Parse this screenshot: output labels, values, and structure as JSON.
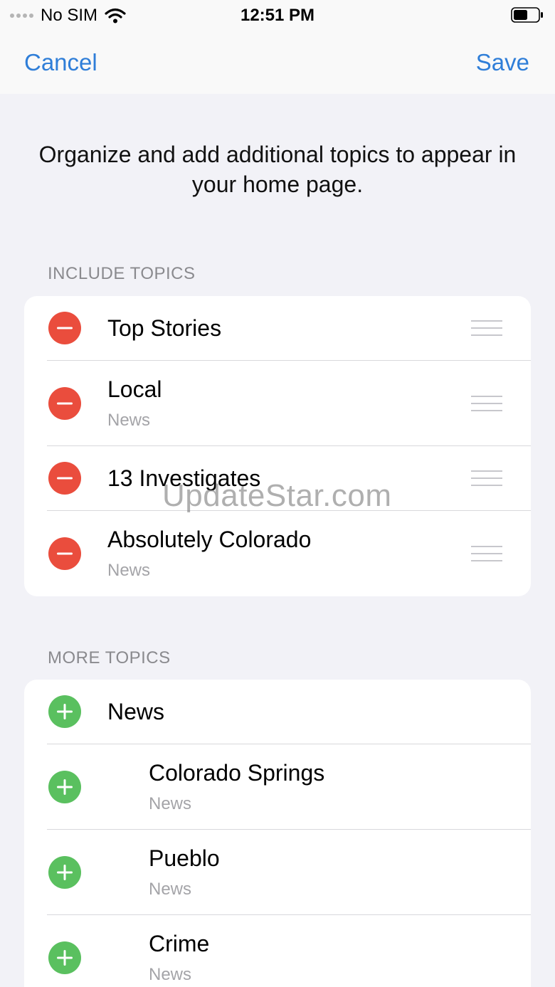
{
  "status_bar": {
    "carrier": "No SIM",
    "time": "12:51 PM"
  },
  "nav": {
    "cancel_label": "Cancel",
    "save_label": "Save"
  },
  "intro_text": "Organize and add additional topics to appear in your home page.",
  "include_section": {
    "header": "INCLUDE TOPICS",
    "items": [
      {
        "title": "Top Stories",
        "subtitle": ""
      },
      {
        "title": "Local",
        "subtitle": "News"
      },
      {
        "title": "13 Investigates",
        "subtitle": ""
      },
      {
        "title": "Absolutely Colorado",
        "subtitle": "News"
      }
    ]
  },
  "more_section": {
    "header": "MORE TOPICS",
    "items": [
      {
        "title": "News",
        "subtitle": ""
      },
      {
        "title": "Colorado Springs",
        "subtitle": "News"
      },
      {
        "title": "Pueblo",
        "subtitle": "News"
      },
      {
        "title": "Crime",
        "subtitle": "News"
      }
    ]
  },
  "watermark": "UpdateStar.com",
  "colors": {
    "accent": "#2f7ed8",
    "remove": "#ea4d3d",
    "add": "#5ac05f",
    "background": "#f2f2f7"
  },
  "icons": {
    "remove": "minus-circle-icon",
    "add": "plus-circle-icon",
    "reorder": "reorder-handle-icon",
    "wifi": "wifi-icon",
    "battery": "battery-icon"
  }
}
